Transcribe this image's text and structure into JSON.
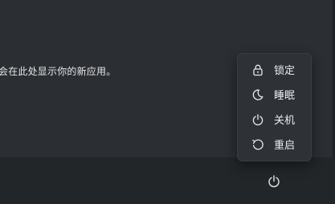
{
  "start_menu": {
    "empty_message": "会在此处显示你的新应用。"
  },
  "power_menu": {
    "items": [
      {
        "label": "锁定",
        "icon": "lock-icon"
      },
      {
        "label": "睡眠",
        "icon": "moon-icon"
      },
      {
        "label": "关机",
        "icon": "power-icon"
      },
      {
        "label": "重启",
        "icon": "restart-icon"
      }
    ]
  },
  "footer": {
    "power_button_icon": "power-icon"
  },
  "colors": {
    "panel_bg": "#2b2e33",
    "footer_bg": "#232629",
    "menu_bg": "#2e3136",
    "text": "#ededed"
  }
}
